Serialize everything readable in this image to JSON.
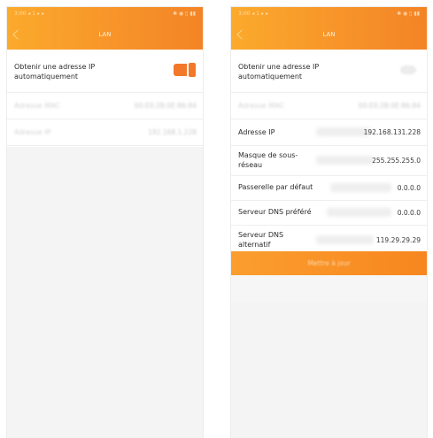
{
  "left_screen": {
    "status_time": "3:00 ◂ 1 ▸ ▸",
    "status_icons": "✱ ◉ ▯ ▮▮",
    "title": "LAN",
    "auto_ip_label": "Obtenir une adresse IP automatiquement",
    "auto_ip_enabled": true,
    "mac_label": "Adresse MAC",
    "mac_value": "00:E0:2B:0E:86:84",
    "ip_label": "Adresse IP",
    "ip_value": "192.168.1.228"
  },
  "right_screen": {
    "status_time": "3:00 ◂ 1 ▸ ▸",
    "status_icons": "✱ ◉ ▯ ▮▮",
    "title": "LAN",
    "auto_ip_label": "Obtenir une adresse IP automatiquement",
    "auto_ip_enabled": false,
    "mac_label": "Adresse MAC",
    "mac_value": "00:E0:2B:0E:86:84",
    "fields": [
      {
        "label": "Adresse IP",
        "value": "192.168.131.228"
      },
      {
        "label": "Masque de sous-réseau",
        "value": "255.255.255.0"
      },
      {
        "label": "Passerelle par défaut",
        "value": "0.0.0.0"
      },
      {
        "label": "Serveur DNS préféré",
        "value": "0.0.0.0"
      },
      {
        "label": "Serveur DNS alternatif",
        "value": "119.29.29.29"
      }
    ],
    "update_button": "Mettre à jour"
  },
  "colors": {
    "header_orange": "#f7942a",
    "toggle_on": "#f2782a",
    "button_orange": "#f7861f"
  }
}
